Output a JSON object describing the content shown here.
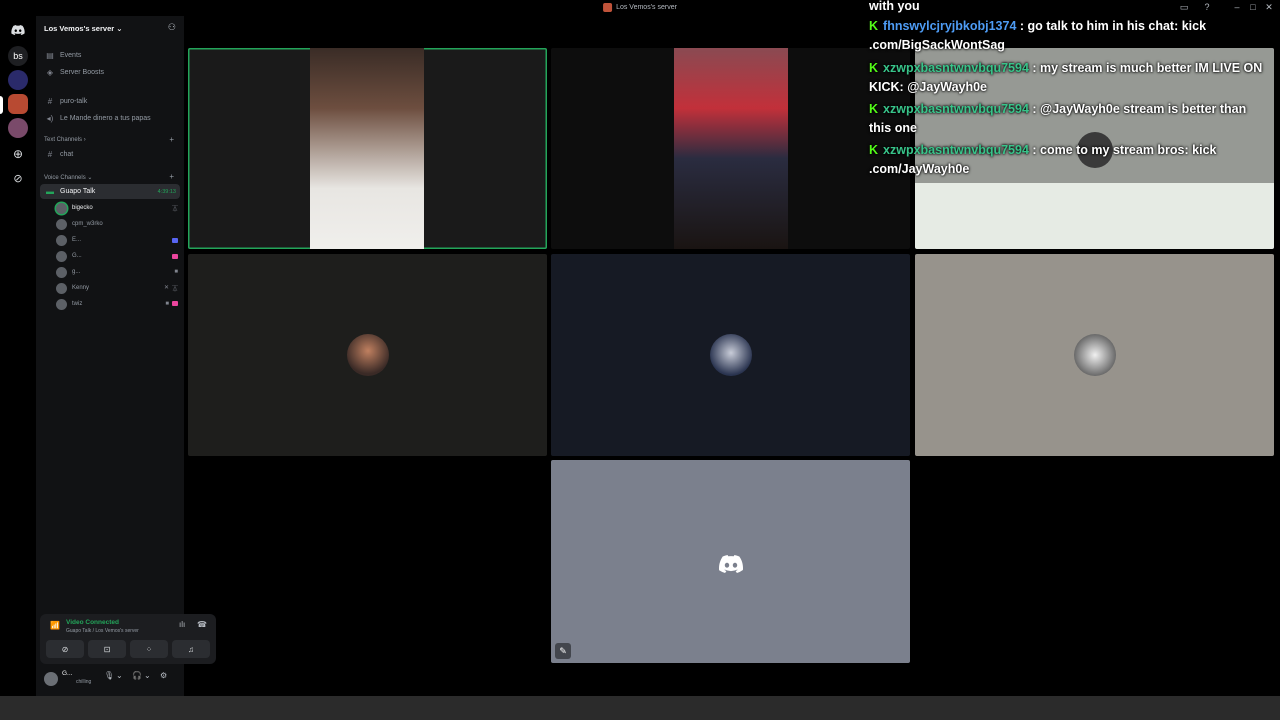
{
  "window": {
    "title": "Los Vemos's server"
  },
  "rail": {
    "home_label": "bs",
    "accent": "#5865f2"
  },
  "sidebar": {
    "server_name": "Los Vemos's server",
    "events_label": "Events",
    "boosts_label": "Server Boosts",
    "channels_top": [
      {
        "label": "puro-talk",
        "icon": "hash-icon"
      },
      {
        "label": "Le Mande dinero a tus papas",
        "icon": "speaker-icon"
      }
    ],
    "text_category": "Text Channels",
    "text_channels": [
      {
        "label": "chat",
        "icon": "hash-icon"
      }
    ],
    "voice_category": "Voice Channels",
    "voice_channel": {
      "label": "Guapo Talk",
      "timer": "4:39:13"
    },
    "voice_users": [
      {
        "name": "bigecko",
        "speaking": true,
        "icons": [
          "deafen"
        ]
      },
      {
        "name": "cpm_w3rko",
        "speaking": false,
        "icons": []
      },
      {
        "name": "E...",
        "speaking": false,
        "icons": [
          "screen"
        ]
      },
      {
        "name": "G...",
        "speaking": false,
        "icons": [
          "live"
        ]
      },
      {
        "name": "g...",
        "speaking": false,
        "icons": [
          "camera"
        ]
      },
      {
        "name": "Kenny",
        "speaking": false,
        "icons": [
          "mute",
          "deafen"
        ]
      },
      {
        "name": "twiz",
        "speaking": false,
        "icons": [
          "camera",
          "live"
        ]
      }
    ]
  },
  "rtc": {
    "status": "Video Connected",
    "location": "Guapo Talk / Los Vemos's server"
  },
  "user": {
    "name": "G...",
    "status": "chilling"
  },
  "chat": {
    "header_fragment": "with you",
    "messages": [
      {
        "user": "fhnswylcjryjbkobj1374",
        "text": " : go talk to him in his chat: kick .com/BigSackWontSag",
        "color": "#4e9cf5"
      },
      {
        "user": "xzwpxbasntwnvbqu7594",
        "text": " : my stream is much better IM LIVE ON KICK: @JayWayh0e",
        "color": "#38c48a"
      },
      {
        "user": "xzwpxbasntwnvbqu7594",
        "text": " : @JayWayh0e stream is better than this one",
        "color": "#38c48a"
      },
      {
        "user": "xzwpxbasntwnvbqu7594",
        "text": " : come to my stream bros: kick .com/JayWayh0e",
        "color": "#38c48a"
      }
    ]
  },
  "colors": {
    "speaking": "#23a55a",
    "kick": "#53fc18",
    "tile_dark": "#1e1e1c",
    "tile_navy": "#161a24",
    "tile_gray": "#97938c",
    "tile_discord": "#7b808d"
  }
}
